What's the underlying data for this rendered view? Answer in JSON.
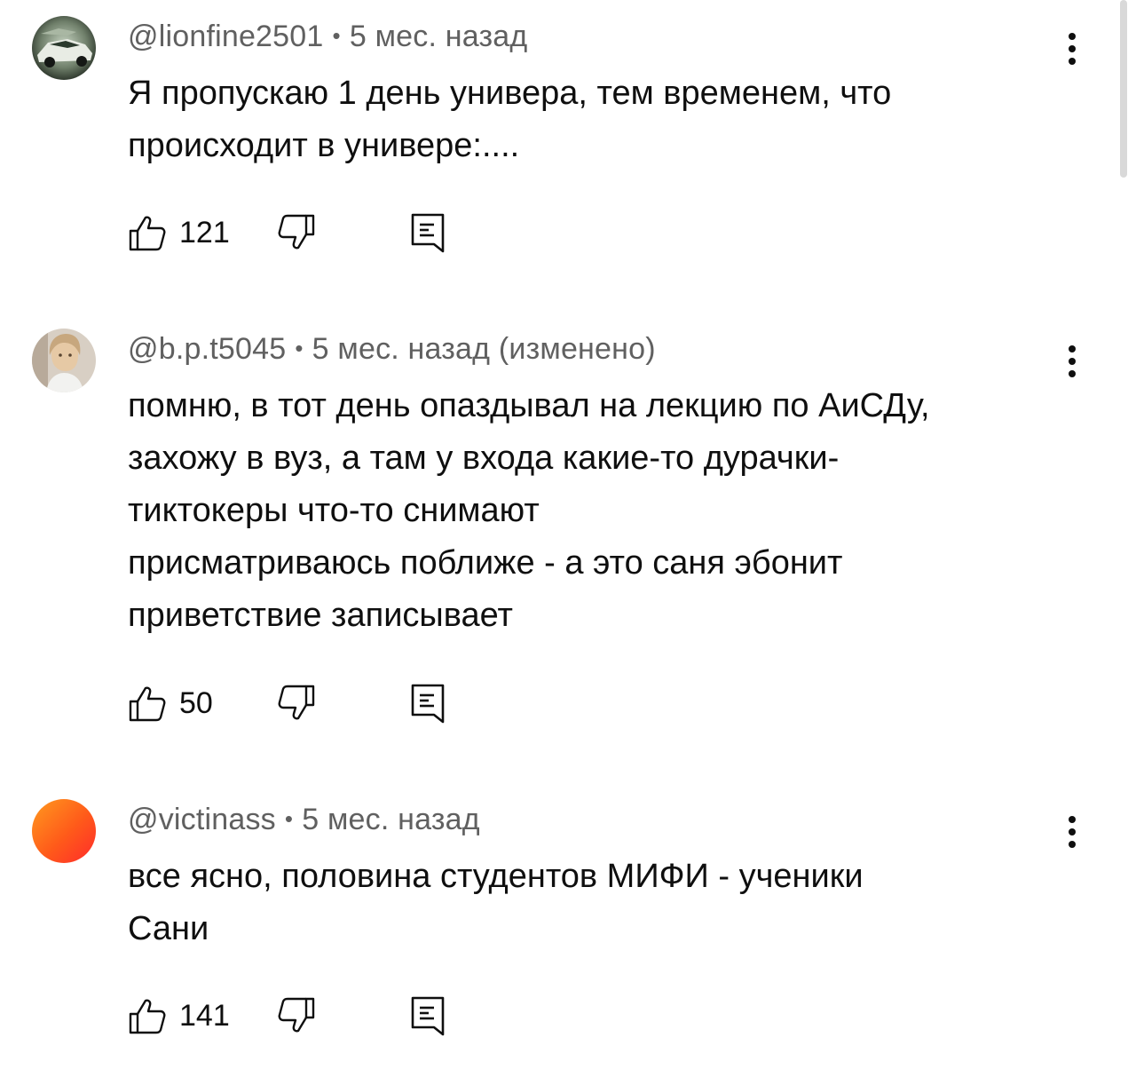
{
  "comments": [
    {
      "author": "@lionfine2501",
      "time": "5 мес. назад",
      "edited": "",
      "text": "Я пропускаю 1 день универа,  тем временем, что\nпроисходит в универе:....",
      "likes": "121",
      "avatar": "car-photo"
    },
    {
      "author": "@b.p.t5045",
      "time": "5 мес. назад",
      "edited": "(изменено)",
      "text": "помню, в тот день опаздывал на лекцию по АиСДу,\nзахожу в вуз, а там у входа какие-то дурачки-\nтиктокеры что-то снимают\nприсматриваюсь поближе - а это саня эбонит\nприветствие записывает",
      "likes": "50",
      "avatar": "person-photo"
    },
    {
      "author": "@victinass",
      "time": "5 мес. назад",
      "edited": "",
      "text": "все ясно, половина студентов МИФИ - ученики\nСани",
      "likes": "141",
      "avatar": "orange-gradient"
    }
  ],
  "icons": {
    "like": "thumb-up-icon",
    "dislike": "thumb-down-icon",
    "reply": "reply-icon",
    "more": "more-vert-icon"
  },
  "colors": {
    "text": "#0f0f0f",
    "meta": "#606060",
    "scrollbar": "#d9d9d9"
  }
}
